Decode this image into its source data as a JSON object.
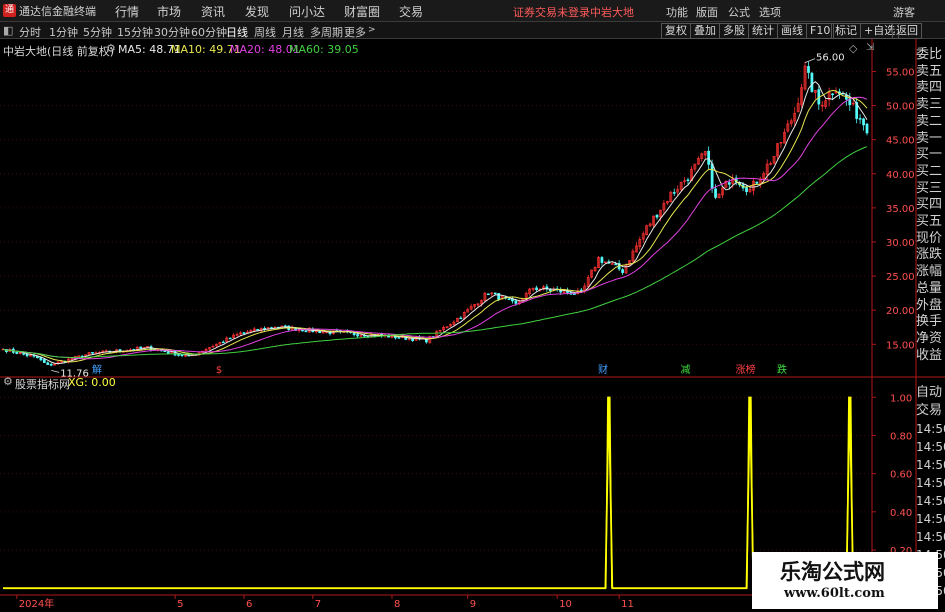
{
  "app": {
    "logo_glyph": "通",
    "title": "通达信金融终端"
  },
  "top_menu": [
    "行情",
    "市场",
    "资讯",
    "发现",
    "问小达",
    "财富圈",
    "交易"
  ],
  "top_status": {
    "trade_status": "证券交易未登录",
    "stock_name": "中岩大地"
  },
  "top_right": [
    "功能",
    "版面",
    "公式",
    "选项",
    "游客"
  ],
  "periods": [
    "分时",
    "1分钟",
    "5分钟",
    "15分钟",
    "30分钟",
    "60分钟",
    "日线",
    "周线",
    "月线",
    "多周期",
    "更多"
  ],
  "active_period": "日线",
  "toolbar_right": [
    "复权",
    "叠加",
    "多股",
    "统计",
    "画线",
    "F10",
    "标记",
    "+自选",
    "返回"
  ],
  "chart_header": {
    "title": "中岩大地(日线 前复权)",
    "ma_items": [
      {
        "label": "MA5: 48.71",
        "color": "#e8e8e8"
      },
      {
        "label": "MA10: 49.71",
        "color": "#e8e850"
      },
      {
        "label": "MA20: 48.01",
        "color": "#e040e0"
      },
      {
        "label": "MA60: 39.05",
        "color": "#40d040"
      }
    ]
  },
  "indicator_header": {
    "name": "股票指标网",
    "value": "XG: 0.00"
  },
  "markers": [
    {
      "text": "解",
      "color": "#40a0ff",
      "date": "2024-04-03"
    },
    {
      "text": "$",
      "color": "#ff4040",
      "date": "2024-05-23"
    },
    {
      "text": "财",
      "color": "#40a0ff",
      "date": "2024-10-25"
    },
    {
      "text": "减",
      "color": "#40e040",
      "date": "2024-11-28"
    },
    {
      "text": "涨榜",
      "color": "#ff4040",
      "date": "2024-12-20"
    },
    {
      "text": "跌",
      "color": "#40e040",
      "date": "2025-01-07"
    }
  ],
  "annotations": {
    "high_label": "56.00",
    "low_label": "11.76"
  },
  "side_panel": {
    "upper": [
      "委比",
      "卖五",
      "卖四",
      "卖三",
      "卖二",
      "卖一",
      "买一",
      "买二",
      "买三",
      "买四",
      "买五",
      "现价",
      "涨跌",
      "涨幅",
      "总量",
      "外盘",
      "换手",
      "净资",
      "收益"
    ],
    "lower": [
      "自动",
      "交易",
      "14:50",
      "14:50",
      "14:50",
      "14:50",
      "14:50",
      "14:50",
      "14:50",
      "14:50",
      "14:50",
      "14:50"
    ]
  },
  "watermark": {
    "line1": "乐淘公式网",
    "line2": "www.60lt.com"
  },
  "colors": {
    "up": "#ff3232",
    "down": "#54fcfc",
    "axis": "#b01818",
    "indicator": "#ffff00"
  },
  "chart_data": {
    "type": "candlestick",
    "price_axis": {
      "ticks": [
        15.0,
        20.0,
        25.0,
        30.0,
        35.0,
        40.0,
        45.0,
        50.0,
        55.0
      ],
      "labels": [
        "15.00",
        "20.00",
        "25.00",
        "30.00",
        "35.00",
        "40.00",
        "45.00",
        "50.00",
        "55.00"
      ],
      "ylim": [
        10.5,
        58.0
      ]
    },
    "indicator_axis": {
      "ticks": [
        0.0,
        0.2,
        0.4,
        0.6,
        0.8,
        1.0
      ],
      "labels": [
        "0.00",
        "0.20",
        "0.40",
        "0.60",
        "0.80",
        "1.00"
      ],
      "ylim": [
        -0.02,
        1.08
      ]
    },
    "x_axis_labels": [
      {
        "text": "2024年",
        "date": "2024-03-01"
      },
      {
        "text": "5",
        "date": "2024-05-06"
      },
      {
        "text": "6",
        "date": "2024-06-03"
      },
      {
        "text": "7",
        "date": "2024-07-01"
      },
      {
        "text": "8",
        "date": "2024-08-01"
      },
      {
        "text": "9",
        "date": "2024-09-02"
      },
      {
        "text": "10",
        "date": "2024-10-08"
      },
      {
        "text": "11",
        "date": "2024-11-01"
      }
    ],
    "close_anchors": [
      {
        "date": "2024-02-26",
        "close": 14.3
      },
      {
        "date": "2024-03-11",
        "close": 13.0
      },
      {
        "date": "2024-03-14",
        "close": 11.9
      },
      {
        "date": "2024-04-01",
        "close": 13.6
      },
      {
        "date": "2024-04-24",
        "close": 14.5
      },
      {
        "date": "2024-05-10",
        "close": 13.2
      },
      {
        "date": "2024-05-31",
        "close": 16.6
      },
      {
        "date": "2024-06-14",
        "close": 17.6
      },
      {
        "date": "2024-07-05",
        "close": 16.8
      },
      {
        "date": "2024-07-31",
        "close": 16.2
      },
      {
        "date": "2024-08-15",
        "close": 15.6
      },
      {
        "date": "2024-08-30",
        "close": 19.5
      },
      {
        "date": "2024-09-10",
        "close": 22.6
      },
      {
        "date": "2024-09-20",
        "close": 20.8
      },
      {
        "date": "2024-09-27",
        "close": 23.3
      },
      {
        "date": "2024-10-17",
        "close": 22.4
      },
      {
        "date": "2024-10-24",
        "close": 27.6
      },
      {
        "date": "2024-11-04",
        "close": 25.8
      },
      {
        "date": "2024-11-13",
        "close": 32.1
      },
      {
        "date": "2024-11-22",
        "close": 37.0
      },
      {
        "date": "2024-11-29",
        "close": 39.6
      },
      {
        "date": "2024-12-06",
        "close": 43.0
      },
      {
        "date": "2024-12-11",
        "close": 36.2
      },
      {
        "date": "2024-12-18",
        "close": 39.8
      },
      {
        "date": "2024-12-25",
        "close": 37.6
      },
      {
        "date": "2025-01-03",
        "close": 42.6
      },
      {
        "date": "2025-01-13",
        "close": 49.0
      },
      {
        "date": "2025-01-16",
        "close": 55.2
      },
      {
        "date": "2025-01-22",
        "close": 50.2
      },
      {
        "date": "2025-01-29",
        "close": 52.8
      },
      {
        "date": "2025-02-05",
        "close": 49.5
      },
      {
        "date": "2025-02-11",
        "close": 46.8
      }
    ],
    "xg_signal_dates": [
      "2024-10-29",
      "2024-12-25",
      "2025-02-04"
    ]
  }
}
